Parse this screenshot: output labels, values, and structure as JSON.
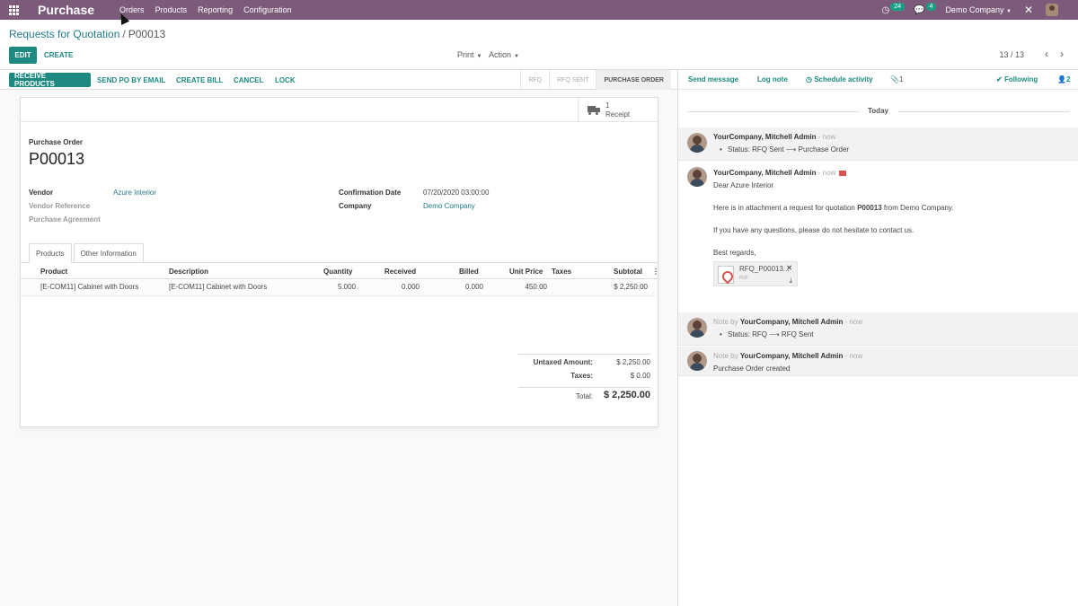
{
  "navbar": {
    "brand": "Purchase",
    "menu": [
      "Orders",
      "Products",
      "Reporting",
      "Configuration"
    ],
    "activity_count": "24",
    "messages_count": "4",
    "company": "Demo Company",
    "accent_color": "#7c5a7a"
  },
  "breadcrumb": {
    "parent": "Requests for Quotation",
    "separator": "/",
    "current": "P00013"
  },
  "control": {
    "edit_label": "EDIT",
    "create_label": "CREATE",
    "print_label": "Print",
    "action_label": "Action",
    "pager": "13 / 13"
  },
  "statusbar": {
    "buttons": [
      "RECEIVE PRODUCTS",
      "SEND PO BY EMAIL",
      "CREATE BILL",
      "CANCEL",
      "LOCK"
    ],
    "stages": [
      "RFQ",
      "RFQ SENT",
      "PURCHASE ORDER"
    ],
    "active_stage": "PURCHASE ORDER"
  },
  "sheet": {
    "receipt_count": "1",
    "receipt_label": "Receipt",
    "doc_type": "Purchase Order",
    "name": "P00013",
    "fields": {
      "vendor_label": "Vendor",
      "vendor_value": "Azure Interior",
      "vendor_ref_label": "Vendor Reference",
      "agreement_label": "Purchase Agreement",
      "confirmation_label": "Confirmation Date",
      "confirmation_value": "07/20/2020 03:00:00",
      "company_label": "Company",
      "company_value": "Demo Company"
    },
    "tabs": [
      "Products",
      "Other Information"
    ],
    "columns": [
      "Product",
      "Description",
      "Quantity",
      "Received",
      "Billed",
      "Unit Price",
      "Taxes",
      "Subtotal"
    ],
    "lines": [
      {
        "product": "[E-COM11] Cabinet with Doors",
        "description": "[E-COM11] Cabinet with Doors",
        "quantity": "5.000",
        "received": "0.000",
        "billed": "0.000",
        "unit_price": "450.00",
        "taxes": "",
        "subtotal": "$ 2,250.00"
      }
    ],
    "totals": {
      "untaxed_label": "Untaxed Amount:",
      "untaxed_value": "$ 2,250.00",
      "taxes_label": "Taxes:",
      "taxes_value": "$ 0.00",
      "total_label": "Total:",
      "total_value": "$ 2,250.00"
    }
  },
  "chatter": {
    "send_message": "Send message",
    "log_note": "Log note",
    "schedule_activity": "Schedule activity",
    "attachments_count": "1",
    "following": "Following",
    "followers_count": "2",
    "day_label": "Today",
    "messages": [
      {
        "author": "YourCompany, Mitchell Admin",
        "time": "now",
        "tracking": "Status: RFQ Sent ⟶ Purchase Order"
      },
      {
        "author": "YourCompany, Mitchell Admin",
        "time": "now",
        "body": [
          "Dear Azure Interior",
          "Here is in attachment a request for quotation ",
          "P00013",
          " from Demo Company.",
          "If you have any questions, please do not hesitate to contact us.",
          "Best regards,"
        ],
        "attachment_name": "RFQ_P00013...",
        "attachment_ext": "PDF"
      },
      {
        "prefix": "Note by",
        "author": "YourCompany, Mitchell Admin",
        "time": "now",
        "tracking": "Status: RFQ ⟶ RFQ Sent"
      },
      {
        "prefix": "Note by",
        "author": "YourCompany, Mitchell Admin",
        "time": "now",
        "body_text": "Purchase Order created"
      }
    ]
  }
}
